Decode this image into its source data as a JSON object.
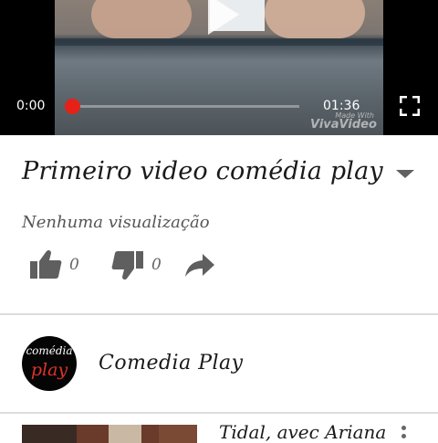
{
  "player": {
    "current_time": "0:00",
    "duration": "01:36",
    "progress": 0,
    "watermark_line1": "Made With",
    "watermark_line2": "VivaVideo",
    "accent_color": "#e62117",
    "play_icon": "play-icon",
    "fullscreen_icon": "fullscreen-icon"
  },
  "video": {
    "title": "Primeiro video comédia play",
    "views": "Nenhuma visualização",
    "likes": "0",
    "dislikes": "0",
    "icons": [
      "thumbs-up-icon",
      "thumbs-down-icon",
      "share-icon",
      "chevron-down-icon"
    ]
  },
  "channel": {
    "name": "Comedia Play",
    "avatar_line1": "comédia",
    "avatar_line2": "play"
  },
  "next_video": {
    "title": "Tidal, avec Ariana",
    "menu_icon": "more-vert-icon"
  }
}
